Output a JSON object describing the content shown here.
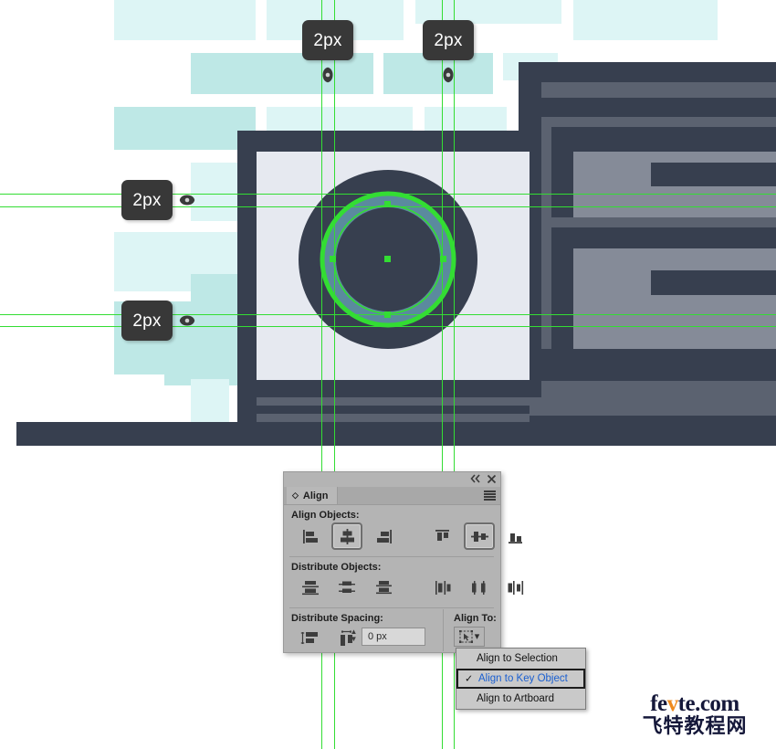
{
  "app": {
    "title": "Align",
    "tab_label": "Align"
  },
  "canvas": {
    "measurement_badges": [
      {
        "label": "2px",
        "position": "top-left-guide"
      },
      {
        "label": "2px",
        "position": "top-right-guide"
      },
      {
        "label": "2px",
        "position": "left-upper-guide"
      },
      {
        "label": "2px",
        "position": "left-lower-guide"
      }
    ],
    "guide_color": "#33dd33",
    "colors": {
      "pale_cyan_light": "#ddf5f5",
      "pale_cyan_mid": "#bee8e6",
      "dark_navy": "#373f4f",
      "panel_lavender": "#e6e9f0",
      "ring_teal": "#5b8a9e",
      "gray_mid": "#5b6270",
      "gray_light": "#858b98"
    }
  },
  "panel": {
    "titlebar": {
      "collapse_icon": "double-chevron-left-icon",
      "close_icon": "close-icon",
      "menu_icon": "hamburger-menu-icon",
      "toggle_icon": "diamond-toggle-icon"
    },
    "align_objects": {
      "label": "Align Objects:",
      "buttons": [
        {
          "name": "horizontal-align-left",
          "pressed": false
        },
        {
          "name": "horizontal-align-center",
          "pressed": true
        },
        {
          "name": "horizontal-align-right",
          "pressed": false
        },
        {
          "name": "vertical-align-top",
          "pressed": false
        },
        {
          "name": "vertical-align-center",
          "pressed": true
        },
        {
          "name": "vertical-align-bottom",
          "pressed": false
        }
      ]
    },
    "distribute_objects": {
      "label": "Distribute Objects:",
      "buttons": [
        {
          "name": "vertical-distribute-top",
          "pressed": false
        },
        {
          "name": "vertical-distribute-center",
          "pressed": false
        },
        {
          "name": "vertical-distribute-bottom",
          "pressed": false
        },
        {
          "name": "horizontal-distribute-left",
          "pressed": false
        },
        {
          "name": "horizontal-distribute-center",
          "pressed": false
        },
        {
          "name": "horizontal-distribute-right",
          "pressed": false
        }
      ]
    },
    "distribute_spacing": {
      "label": "Distribute Spacing:",
      "buttons": [
        {
          "name": "vertical-distribute-spacing",
          "pressed": false
        },
        {
          "name": "horizontal-distribute-spacing",
          "pressed": false
        }
      ],
      "value": "0 px",
      "stepper_up": "▲",
      "stepper_down": "▼"
    },
    "align_to": {
      "label": "Align To:",
      "button_icon": "key-object-icon",
      "chevron": "⌄"
    }
  },
  "dropdown": {
    "items": [
      {
        "label": "Align to Selection",
        "selected": false,
        "check": ""
      },
      {
        "label": "Align to Key Object",
        "selected": true,
        "check": "✓"
      },
      {
        "label": "Align to Artboard",
        "selected": false,
        "check": ""
      }
    ],
    "selected_color": "#1a5fd0"
  },
  "watermark": {
    "line1_pre": "fe",
    "line1_accent": "v",
    "line1_post": "te.com",
    "line2": "飞特教程网",
    "accent_color": "#ef8a1d"
  }
}
